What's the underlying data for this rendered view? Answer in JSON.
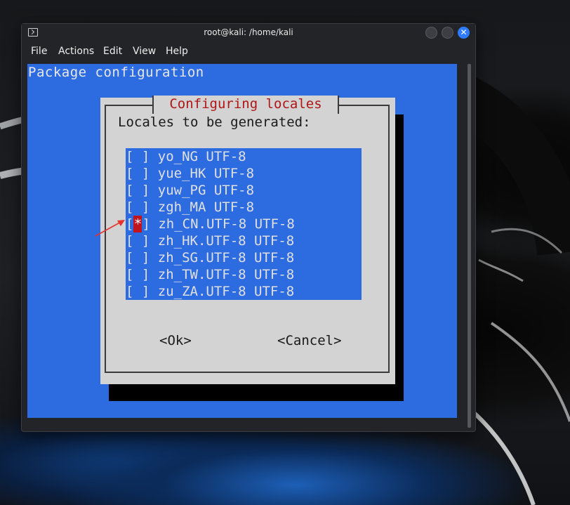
{
  "window": {
    "title": "root@kali: /home/kali",
    "close_glyph": "✕"
  },
  "menu": [
    "File",
    "Actions",
    "Edit",
    "View",
    "Help"
  ],
  "terminal": {
    "header": "Package configuration",
    "dialog": {
      "title": "Configuring locales",
      "prompt": "Locales to be generated:",
      "items": [
        {
          "checked": false,
          "label": "yo_NG UTF-8"
        },
        {
          "checked": false,
          "label": "yue_HK UTF-8"
        },
        {
          "checked": false,
          "label": "yuw_PG UTF-8"
        },
        {
          "checked": false,
          "label": "zgh_MA UTF-8"
        },
        {
          "checked": true,
          "label": "zh_CN.UTF-8 UTF-8"
        },
        {
          "checked": false,
          "label": "zh_HK.UTF-8 UTF-8"
        },
        {
          "checked": false,
          "label": "zh_SG.UTF-8 UTF-8"
        },
        {
          "checked": false,
          "label": "zh_TW.UTF-8 UTF-8"
        },
        {
          "checked": false,
          "label": "zu_ZA.UTF-8 UTF-8"
        }
      ],
      "ok_label": "<Ok>",
      "cancel_label": "<Cancel>"
    }
  },
  "colors": {
    "terminal_bg": "#2d6be0",
    "dialog_bg": "#d3d3d3",
    "title_red": "#b01515",
    "selected_marker": "#c0141f",
    "annotation_arrow": "#e5322d"
  },
  "icons": {
    "terminal_app": "terminal-icon",
    "minimize": "minimize-icon",
    "maximize": "maximize-icon",
    "close": "close-icon"
  }
}
